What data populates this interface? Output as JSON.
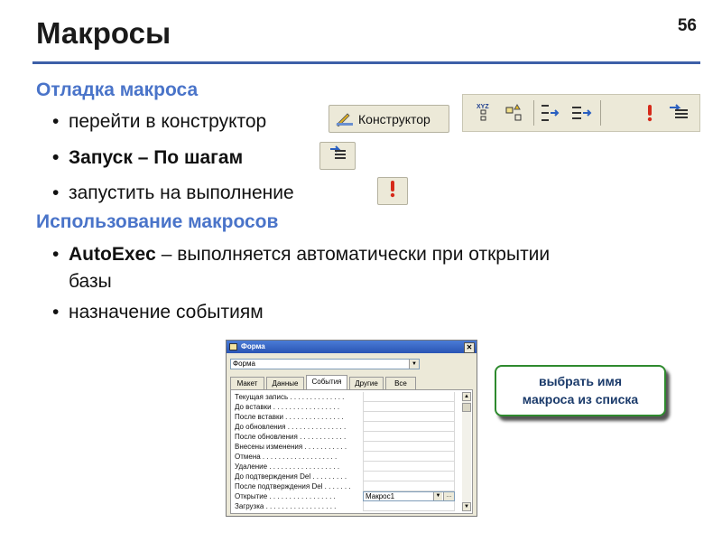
{
  "slide": {
    "title": "Макросы",
    "number": "56"
  },
  "sections": [
    {
      "heading": "Отладка макроса",
      "bullets": [
        "перейти в конструктор",
        "Запуск – По шагам",
        "запустить  на выполнение"
      ]
    },
    {
      "heading": "Использование макросов",
      "bullets": [
        {
          "bold": "AutoExec",
          "rest": " – выполняется автоматически при открытии"
        },
        "базы",
        "назначение событиям"
      ]
    }
  ],
  "buttons": {
    "constructor_label": "Конструктор",
    "constructor_icon": "design-ruler-icon",
    "step_icon": "step-icon",
    "run_icon": "run-exclamation-icon"
  },
  "toolbar": {
    "icons": [
      "macro-names-icon",
      "conditions-icon",
      "insert-row-icon",
      "delete-row-icon",
      "run-icon",
      "single-step-icon"
    ]
  },
  "dialog": {
    "title": "Форма",
    "combo_value": "Форма",
    "tabs": [
      "Макет",
      "Данные",
      "События",
      "Другие",
      "Все"
    ],
    "active_tab": "События",
    "properties": [
      {
        "label": "Текущая запись . . . . . . . . . . . . . .",
        "value": ""
      },
      {
        "label": "До вставки . . . . . . . . . . . . . . . . .",
        "value": ""
      },
      {
        "label": "После вставки . . . . . . . . . . . . . . .",
        "value": ""
      },
      {
        "label": "До обновления . . . . . . . . . . . . . . .",
        "value": ""
      },
      {
        "label": "После обновления . . . . . . . . . . . .",
        "value": ""
      },
      {
        "label": "Внесены изменения . . . . . . . . . . .",
        "value": ""
      },
      {
        "label": "Отмена . . . . . . . . . . . . . . . . . . .",
        "value": ""
      },
      {
        "label": "Удаление . . . . . . . . . . . . . . . . . .",
        "value": ""
      },
      {
        "label": "До подтверждения Del . . . . . . . . .",
        "value": ""
      },
      {
        "label": "После подтверждения Del . . . . . . .",
        "value": ""
      },
      {
        "label": "Открытие . . . . . . . . . . . . . . . . .",
        "value": "Макрос1"
      },
      {
        "label": "Загрузка . . . . . . . . . . . . . . . . . .",
        "value": ""
      }
    ]
  },
  "callout": {
    "line1": "выбрать имя",
    "line2": "макроса из списка"
  },
  "colors": {
    "heading": "#4a74c9",
    "rule": "#3d5fa8",
    "callout_border": "#2e8a2e"
  }
}
